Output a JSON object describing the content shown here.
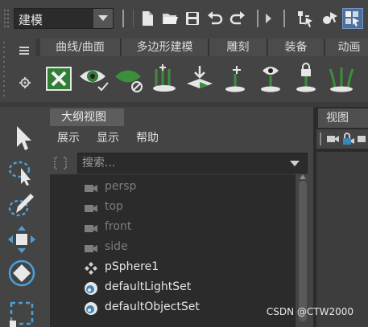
{
  "status_line": {
    "mode_value": "建模"
  },
  "shelf": {
    "tabs": [
      "曲线/曲面",
      "多边形建模",
      "雕刻",
      "装备",
      "动画"
    ]
  },
  "outliner": {
    "tab_title": "大纲视图",
    "menu": [
      "展示",
      "显示",
      "帮助"
    ],
    "search_placeholder": "搜索...",
    "items": [
      {
        "label": "persp",
        "icon": "camera-icon",
        "dim": true
      },
      {
        "label": "top",
        "icon": "camera-icon",
        "dim": true
      },
      {
        "label": "front",
        "icon": "camera-icon",
        "dim": true
      },
      {
        "label": "side",
        "icon": "camera-icon",
        "dim": true
      },
      {
        "label": "pSphere1",
        "icon": "transform-node-icon",
        "dim": false
      },
      {
        "label": "defaultLightSet",
        "icon": "object-set-icon",
        "dim": false
      },
      {
        "label": "defaultObjectSet",
        "icon": "object-set-icon",
        "dim": false
      }
    ]
  },
  "viewport": {
    "tab_title": "视图"
  },
  "watermark": "CSDN @CTW2000",
  "colors": {
    "panel_bg": "#444444",
    "field_bg": "#2b2b2b",
    "shelf_green": "#3c8f3a",
    "dim_text": "#7d7d7d",
    "highlight_blue": "#4d6f9e"
  }
}
